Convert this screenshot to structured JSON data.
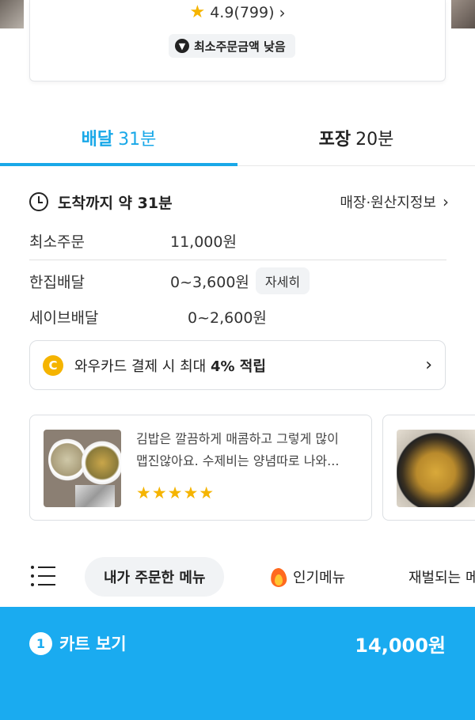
{
  "store": {
    "rating": "4.9(799)",
    "min_order_badge": "최소주문금액 낮음"
  },
  "tabs": [
    {
      "label": "배달",
      "time": "31분",
      "active": true
    },
    {
      "label": "포장",
      "time": "20분",
      "active": false
    }
  ],
  "info": {
    "arrival": "도착까지 약 31분",
    "store_info_link": "매장·원산지정보",
    "min_order_label": "최소주문",
    "min_order_value": "11,000원",
    "delivery_label": "한집배달",
    "delivery_value": "0~3,600원",
    "detail_button": "자세히",
    "save_delivery_label": "세이브배달",
    "save_delivery_value": "0~2,600원"
  },
  "promo": {
    "coin_letter": "C",
    "text": "와우카드 결제 시 최대 ",
    "highlight": "4% 적립"
  },
  "reviews": [
    {
      "line1": "김밥은 깔끔하게 매콤하고 그렇게 많이",
      "line2": "맵진않아요. 수제비는 양념따로 나와...",
      "stars": "★★★★★",
      "rating": 5
    }
  ],
  "menu_bar": {
    "active_chip": "내가 주문한 메뉴",
    "popular_chip": "인기메뉴",
    "trending_chip": "재벌되는 메"
  },
  "cart": {
    "count": "1",
    "label": "카트 보기",
    "total": "14,000원"
  },
  "colors": {
    "accent": "#19a8e8",
    "cart_bg": "#1aabf0",
    "star": "#f5b400"
  }
}
